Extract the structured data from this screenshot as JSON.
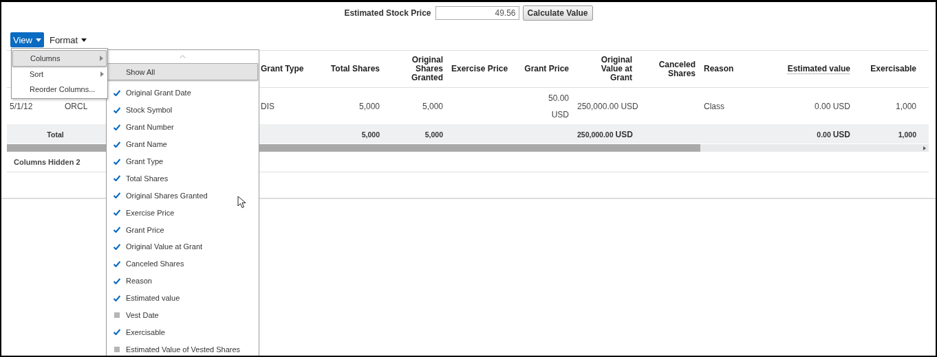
{
  "valuation": {
    "label": "Estimated Stock Price",
    "value": "49.56",
    "button": "Calculate Value"
  },
  "toolbar": [
    {
      "label": "View",
      "selected": true
    },
    {
      "label": "Format",
      "selected": false
    }
  ],
  "view_menu": {
    "items": [
      {
        "label": "Columns",
        "has_submenu": true,
        "selected": true
      },
      {
        "label": "Sort",
        "has_submenu": true,
        "selected": false
      },
      {
        "label": "Reorder Columns...",
        "has_submenu": false,
        "selected": false
      }
    ]
  },
  "columns_menu": {
    "items": [
      {
        "label": "Show All",
        "kind": "action",
        "selected": true
      },
      {
        "label": "Original Grant Date",
        "kind": "toggle",
        "checked": true,
        "selected": false
      },
      {
        "label": "Stock Symbol",
        "kind": "toggle",
        "checked": true,
        "selected": false
      },
      {
        "label": "Grant Number",
        "kind": "toggle",
        "checked": true,
        "selected": false
      },
      {
        "label": "Grant Name",
        "kind": "toggle",
        "checked": true,
        "selected": false
      },
      {
        "label": "Grant Type",
        "kind": "toggle",
        "checked": true,
        "selected": false
      },
      {
        "label": "Total Shares",
        "kind": "toggle",
        "checked": true,
        "selected": false
      },
      {
        "label": "Original Shares Granted",
        "kind": "toggle",
        "checked": true,
        "selected": false
      },
      {
        "label": "Exercise Price",
        "kind": "toggle",
        "checked": true,
        "selected": false
      },
      {
        "label": "Grant Price",
        "kind": "toggle",
        "checked": true,
        "selected": false
      },
      {
        "label": "Original Value at Grant",
        "kind": "toggle",
        "checked": true,
        "selected": false
      },
      {
        "label": "Canceled Shares",
        "kind": "toggle",
        "checked": true,
        "selected": false
      },
      {
        "label": "Reason",
        "kind": "toggle",
        "checked": true,
        "selected": false
      },
      {
        "label": "Estimated value",
        "kind": "toggle",
        "checked": true,
        "selected": false
      },
      {
        "label": "Vest Date",
        "kind": "toggle",
        "checked": false,
        "selected": false
      },
      {
        "label": "Exercisable",
        "kind": "toggle",
        "checked": true,
        "selected": false
      },
      {
        "label": "Estimated Value of Vested Shares",
        "kind": "toggle",
        "checked": false,
        "selected": false
      }
    ]
  },
  "table": {
    "columns": [
      {
        "header": "Grant Type",
        "underlined": false
      },
      {
        "header": "Total Shares",
        "underlined": false
      },
      {
        "header": "Original Shares Granted",
        "underlined": false
      },
      {
        "header": "Exercise Price",
        "underlined": false
      },
      {
        "header": "Grant Price",
        "underlined": false
      },
      {
        "header": "Original Value at Grant",
        "underlined": false
      },
      {
        "header": "Canceled Shares",
        "underlined": false
      },
      {
        "header": "Reason",
        "underlined": false
      },
      {
        "header": "Estimated value",
        "underlined": true
      },
      {
        "header": "Exercisable",
        "underlined": false
      }
    ],
    "rows": [
      {
        "column_1": "5/1/12",
        "column_2": "ORCL",
        "grant_type": "DIS",
        "total_shares": "5,000",
        "original_shares_granted": "5,000",
        "grant_price": "50.00 USD",
        "original_value_at_grant": "250,000.00 USD",
        "reason": "Class",
        "estimated_value": "0.00 USD",
        "exercisable": "1,000"
      }
    ],
    "total_row": {
      "label": "Total",
      "total_shares": "5,000",
      "original_shares_granted": "5,000",
      "original_value_at_grant": "250,000.00 **USD**",
      "estimated_value": "0.00 **USD**",
      "exercisable": "1,000"
    }
  },
  "hidden_columns": {
    "label": "Columns Hidden",
    "count": "2"
  }
}
